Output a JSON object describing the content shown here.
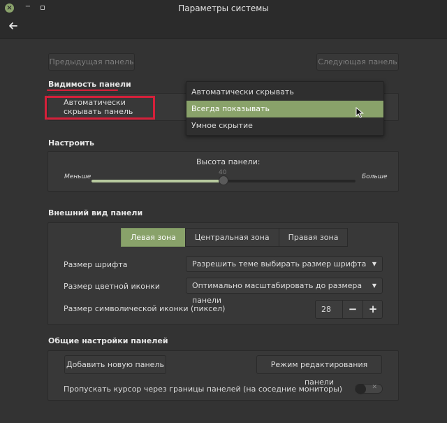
{
  "window": {
    "title": "Параметры системы",
    "close_glyph": "×",
    "min_glyph": "−"
  },
  "nav": {
    "prev_panel": "Предыдущая панель",
    "next_panel": "Следующая панель"
  },
  "visibility": {
    "title": "Видимость панели",
    "label": "Автоматически скрывать панель",
    "dropdown": {
      "options": [
        "Автоматически скрывать",
        "Всегда показывать",
        "Умное скрытие"
      ],
      "selected_index": 1
    }
  },
  "customize": {
    "title": "Настроить",
    "height_label": "Высота панели:",
    "min_label": "Меньше",
    "max_label": "Больше",
    "height_value": "40",
    "slider_fraction": 0.5
  },
  "appearance": {
    "title": "Внешний вид панели",
    "tabs": [
      {
        "label": "Левая зона",
        "active": true
      },
      {
        "label": "Центральная зона",
        "active": false
      },
      {
        "label": "Правая зона",
        "active": false
      }
    ],
    "font_size_label": "Размер шрифта",
    "font_size_value": "Разрешить теме выбирать размер шрифта",
    "color_icon_label": "Размер цветной иконки",
    "color_icon_value": "Оптимально масштабировать до размера панели",
    "symbolic_icon_label": "Размер символической иконки (пиксел)",
    "symbolic_icon_value": "28"
  },
  "general": {
    "title": "Общие настройки панелей",
    "add_panel": "Добавить новую панель",
    "edit_mode": "Режим редактирования панели",
    "pass_cursor_label": "Пропускать курсор через границы панелей (на соседние мониторы)",
    "pass_cursor_enabled": false
  },
  "colors": {
    "accent": "#89a26a",
    "highlight_red": "#d5203a",
    "background": "#333333"
  }
}
